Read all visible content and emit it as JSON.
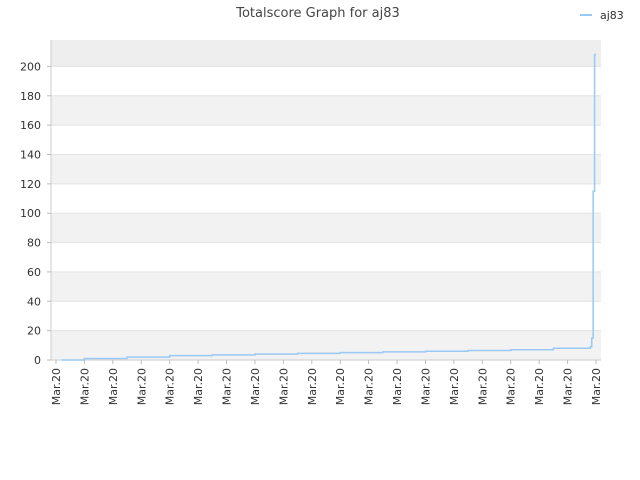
{
  "chart_data": {
    "type": "line",
    "title": "Totalscore Graph for aj83",
    "xlabel": "",
    "ylabel": "",
    "ylim": [
      0,
      218
    ],
    "yticks": [
      0,
      20,
      40,
      60,
      80,
      100,
      120,
      140,
      160,
      180,
      200
    ],
    "xtick_labels": [
      "Mar.20",
      "Mar.20",
      "Mar.20",
      "Mar.20",
      "Mar.20",
      "Mar.20",
      "Mar.20",
      "Mar.20",
      "Mar.20",
      "Mar.20",
      "Mar.20",
      "Mar.20",
      "Mar.20",
      "Mar.20",
      "Mar.20",
      "Mar.20",
      "Mar.20",
      "Mar.20",
      "Mar.20",
      "Mar.20"
    ],
    "grid": true,
    "legend_position": "top-right",
    "series": [
      {
        "name": "aj83",
        "color": "#99c9f4",
        "x": [
          0.2,
          1,
          1,
          2.5,
          2.5,
          4,
          4,
          5.5,
          5.5,
          7,
          7,
          8.5,
          8.5,
          10,
          10,
          11.5,
          11.5,
          13,
          13,
          14.5,
          14.5,
          16,
          16,
          17.5,
          17.5,
          18.8,
          18.8,
          18.85,
          18.85,
          18.9,
          18.9,
          18.95,
          18.95,
          19.0
        ],
        "values": [
          0,
          0,
          1,
          1,
          2,
          2,
          3,
          3,
          3.5,
          3.5,
          4,
          4,
          4.5,
          4.5,
          5,
          5,
          5.5,
          5.5,
          6,
          6,
          6.5,
          6.5,
          7,
          7,
          8,
          8,
          9,
          9,
          15,
          15,
          115,
          115,
          208,
          208
        ]
      }
    ]
  }
}
